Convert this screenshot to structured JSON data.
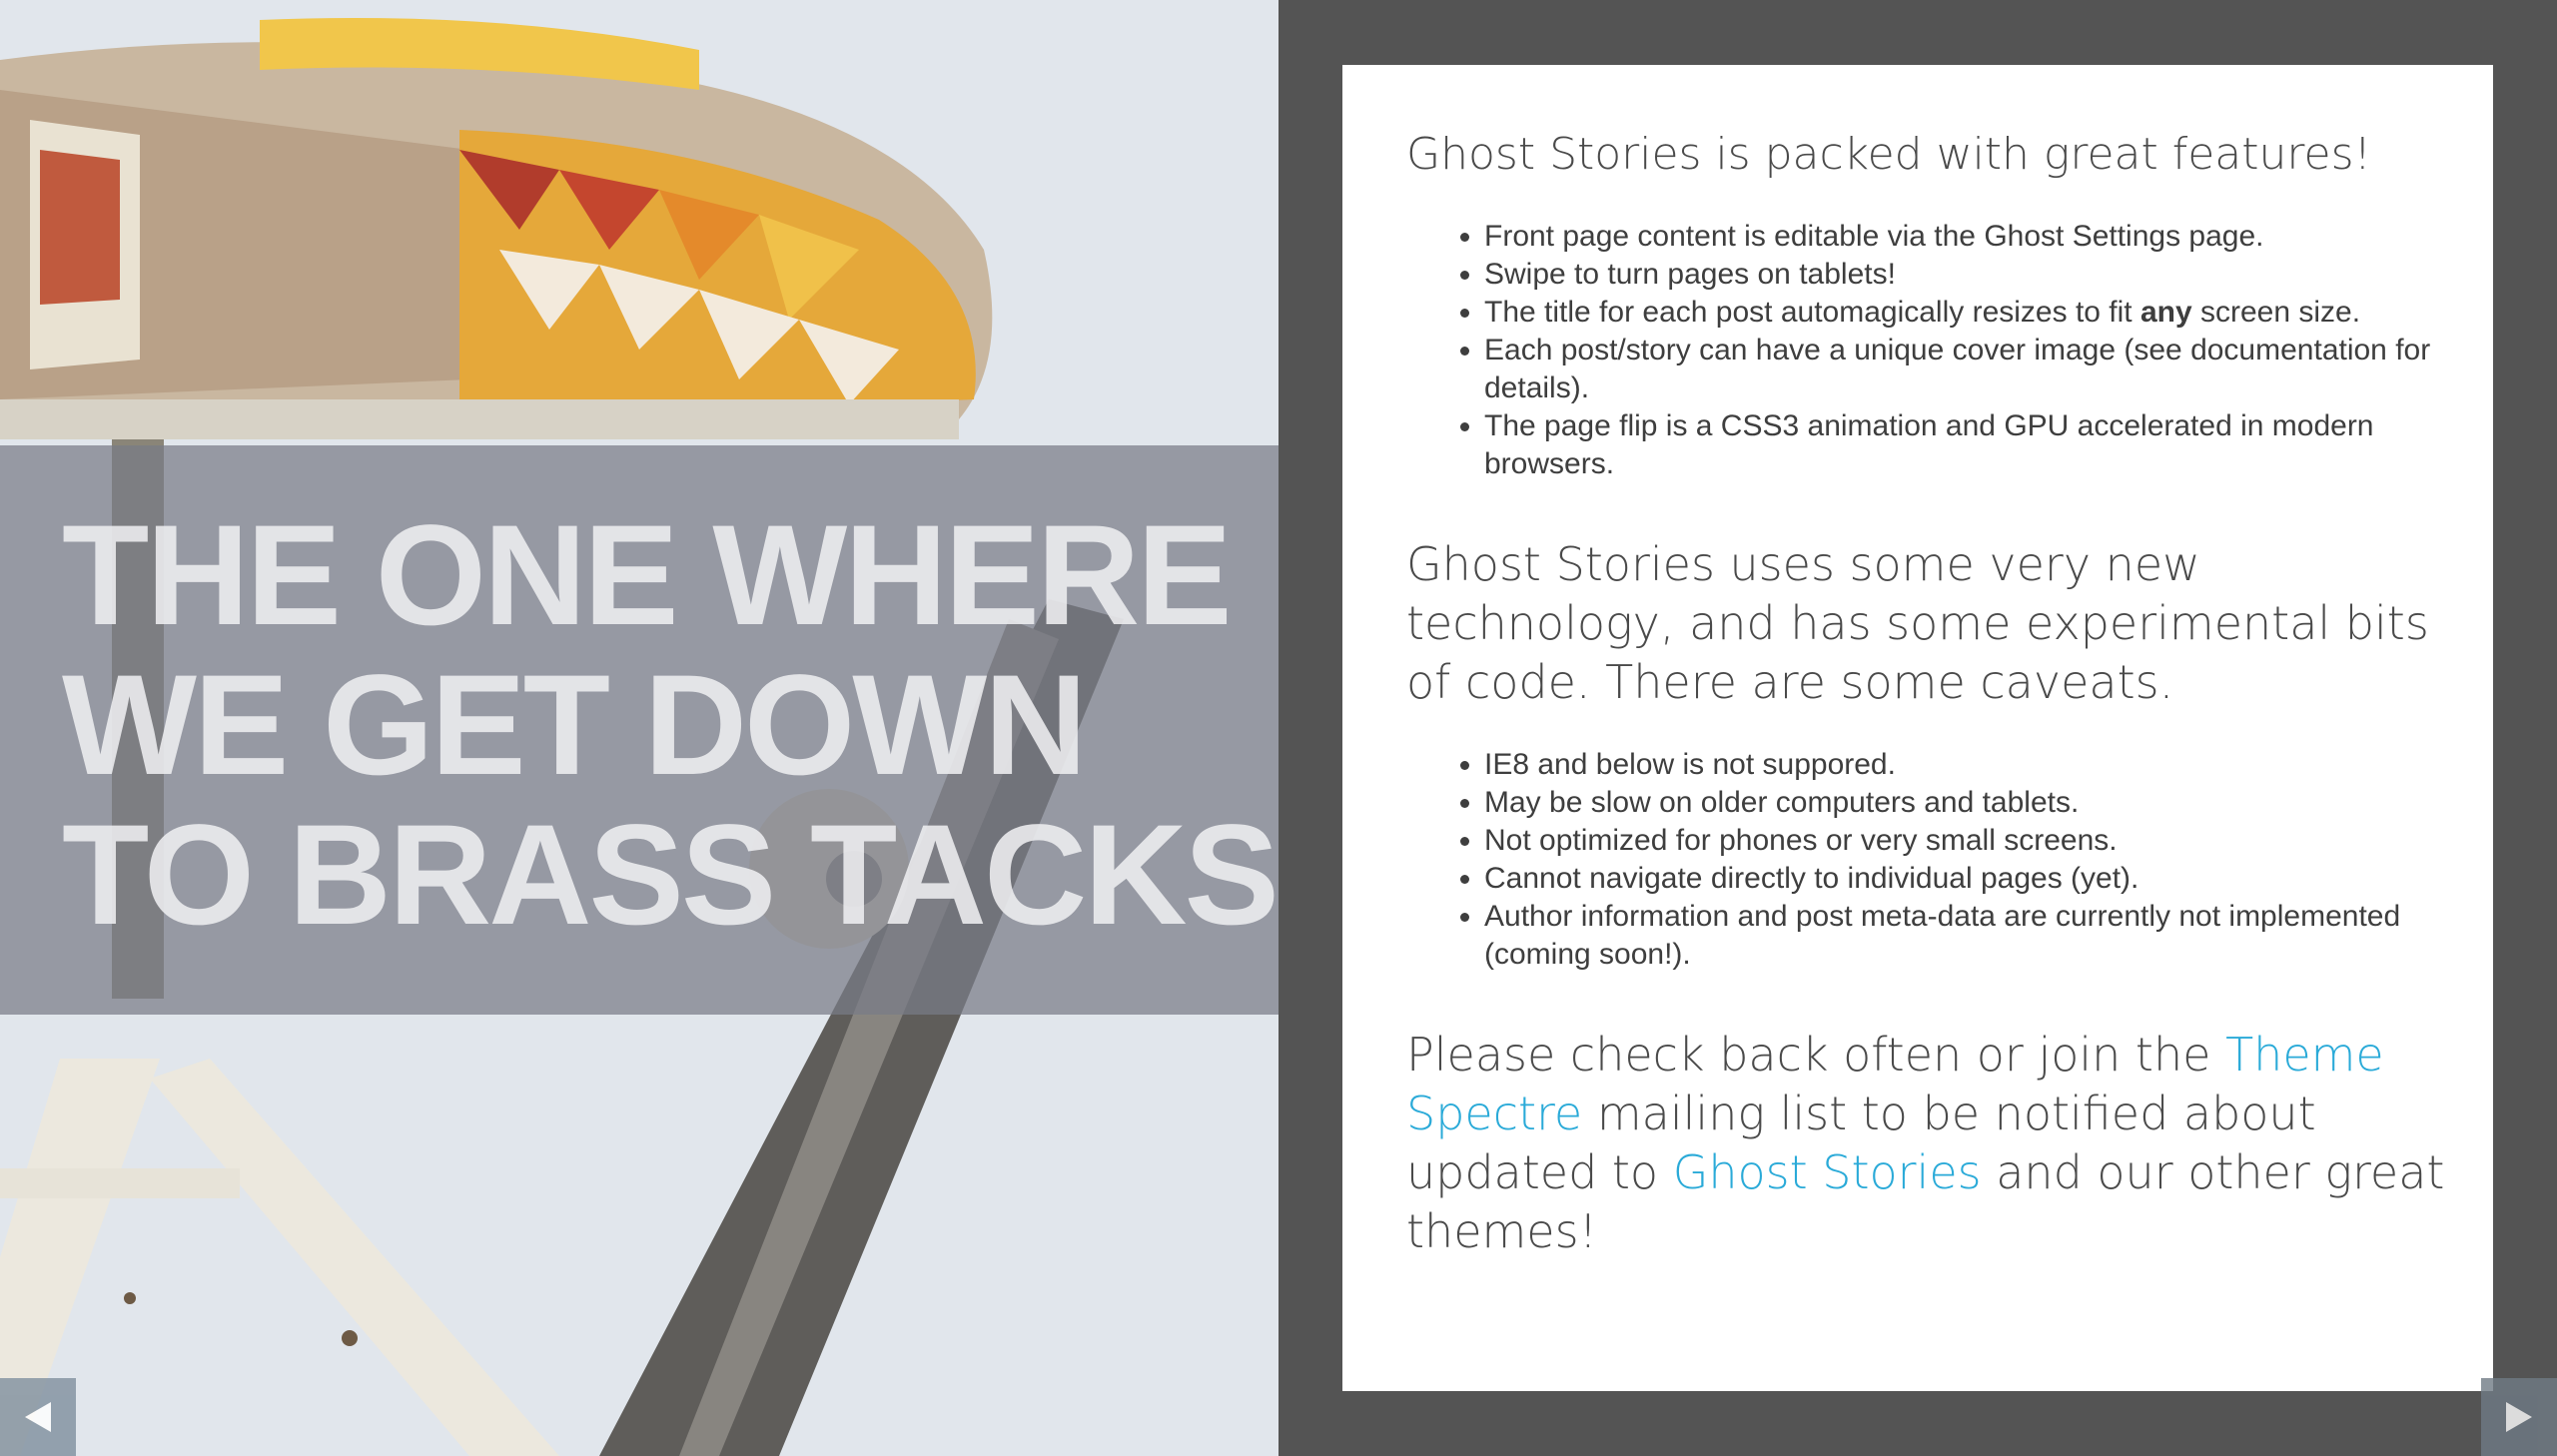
{
  "cover": {
    "title_lines": [
      "THE ONE WHERE",
      "WE GET DOWN",
      "TO BRASS TACKS"
    ]
  },
  "page": {
    "intro": "Ghost Stories is packed with great features!",
    "features": [
      {
        "text": "Front page content is editable via the Ghost Settings page."
      },
      {
        "text": "Swipe to turn pages on tablets!"
      },
      {
        "pre": "The title for each post automagically resizes to fit ",
        "bold": "any",
        "post": " screen size."
      },
      {
        "text": "Each post/story can have a unique cover image (see documentation for details)."
      },
      {
        "text": "The page flip is a CSS3 animation and GPU accelerated in modern browsers."
      }
    ],
    "caveats_intro": "Ghost Stories uses some very new technology, and has some experimental bits of code. There are some caveats.",
    "caveats": [
      "IE8 and below is not suppored.",
      "May be slow on older computers and tablets.",
      "Not optimized for phones or very small screens.",
      "Cannot navigate directly to individual pages (yet).",
      "Author information and post meta-data are currently not implemented (coming soon!)."
    ],
    "outro": {
      "part1": "Please check back often or join the ",
      "link1": "Theme Spectre",
      "part2": " mailing list to be notified about updated to ",
      "link2": "Ghost Stories",
      "part3": " and our other great themes!"
    }
  },
  "nav": {
    "prev_icon": "triangle-left-icon",
    "next_icon": "triangle-right-icon"
  },
  "colors": {
    "link": "#2aaad8",
    "frame": "#545454",
    "band": "#787c86"
  }
}
